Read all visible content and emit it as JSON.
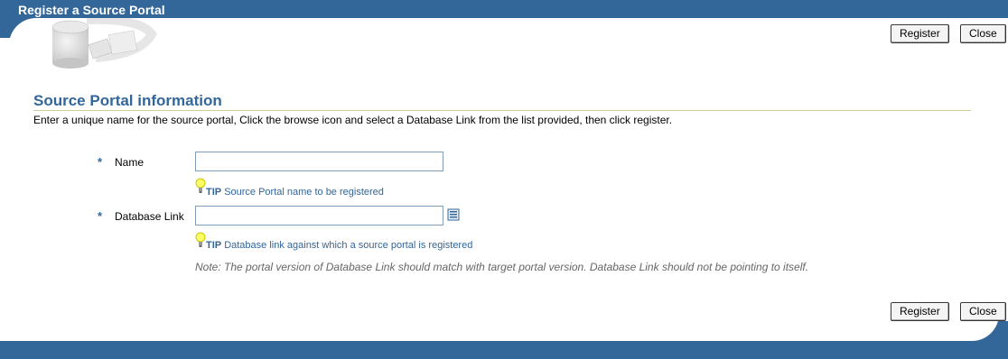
{
  "header": {
    "title": "Register a Source Portal"
  },
  "buttons": {
    "register": "Register",
    "close": "Close"
  },
  "section": {
    "title": "Source Portal information",
    "instructions": "Enter a unique name for the source portal, Click the browse icon and select a Database Link from the list provided, then click register."
  },
  "form": {
    "required_marker": "*",
    "name": {
      "label": "Name",
      "value": "",
      "tip_prefix": "TIP",
      "tip": "Source Portal name to be registered"
    },
    "database_link": {
      "label": "Database Link",
      "value": "",
      "tip_prefix": "TIP",
      "tip": "Database link against which a source portal is registered"
    },
    "note": "Note: The portal version of Database Link should match with target portal version. Database Link should not be pointing to itself."
  },
  "colors": {
    "brand_blue": "#336699",
    "rule": "#cccc99",
    "note_gray": "#666666"
  },
  "icons": [
    "portal-logo-icon",
    "tip-lightbulb-icon",
    "browse-list-icon"
  ]
}
